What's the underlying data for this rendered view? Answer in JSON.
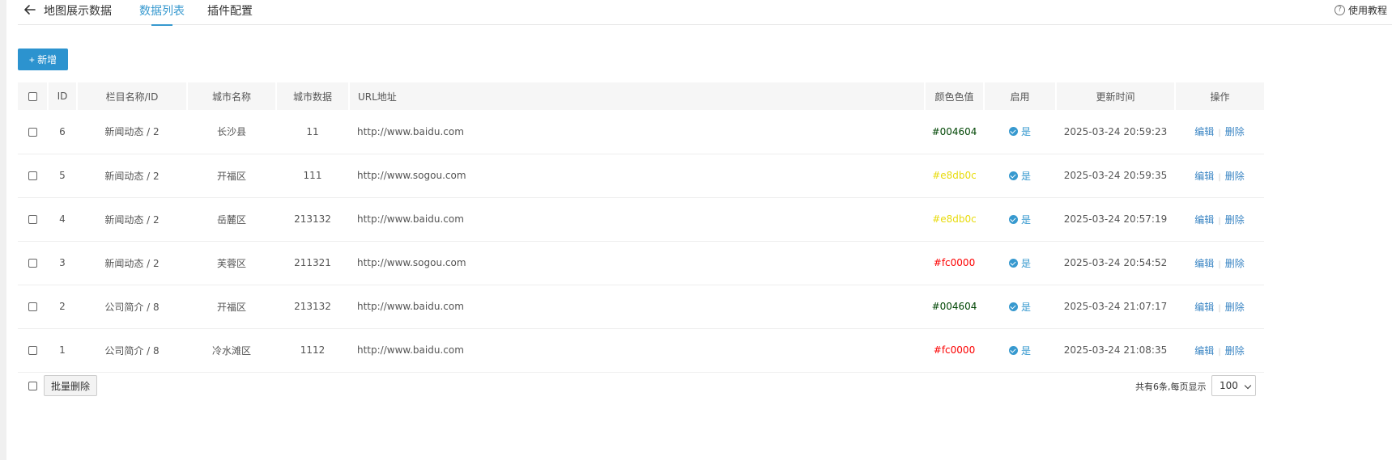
{
  "header": {
    "title": "地图展示数据",
    "tabs": [
      {
        "label": "数据列表",
        "active": true
      },
      {
        "label": "插件配置",
        "active": false
      }
    ],
    "help_label": "使用教程",
    "help_icon_glyph": "?"
  },
  "toolbar": {
    "add_label": "+ 新增"
  },
  "table": {
    "headers": {
      "id": "ID",
      "column": "栏目名称/ID",
      "city": "城市名称",
      "city_data": "城市数据",
      "url": "URL地址",
      "color": "颜色色值",
      "enabled": "启用",
      "updated": "更新时间",
      "actions": "操作"
    },
    "rows": [
      {
        "id": "6",
        "column": "新闻动态 / 2",
        "city": "长沙县",
        "city_data": "11",
        "url": "http://www.baidu.com",
        "color": "#004604",
        "enabled": "是",
        "updated": "2025-03-24 20:59:23"
      },
      {
        "id": "5",
        "column": "新闻动态 / 2",
        "city": "开福区",
        "city_data": "111",
        "url": "http://www.sogou.com",
        "color": "#e8db0c",
        "enabled": "是",
        "updated": "2025-03-24 20:59:35"
      },
      {
        "id": "4",
        "column": "新闻动态 / 2",
        "city": "岳麓区",
        "city_data": "213132",
        "url": "http://www.baidu.com",
        "color": "#e8db0c",
        "enabled": "是",
        "updated": "2025-03-24 20:57:19"
      },
      {
        "id": "3",
        "column": "新闻动态 / 2",
        "city": "芙蓉区",
        "city_data": "211321",
        "url": "http://www.sogou.com",
        "color": "#fc0000",
        "enabled": "是",
        "updated": "2025-03-24 20:54:52"
      },
      {
        "id": "2",
        "column": "公司简介 / 8",
        "city": "开福区",
        "city_data": "213132",
        "url": "http://www.baidu.com",
        "color": "#004604",
        "enabled": "是",
        "updated": "2025-03-24 21:07:17"
      },
      {
        "id": "1",
        "column": "公司简介 / 8",
        "city": "冷水滩区",
        "city_data": "1112",
        "url": "http://www.baidu.com",
        "color": "#fc0000",
        "enabled": "是",
        "updated": "2025-03-24 21:08:35"
      }
    ],
    "edit_label": "编辑",
    "delete_label": "删除",
    "action_separator": "|"
  },
  "footer": {
    "batch_delete_label": "批量删除",
    "total_text": "共有6条,每页显示",
    "page_size": "100"
  },
  "colors": {
    "accent": "#2c93cf",
    "link": "#3b86c4"
  }
}
